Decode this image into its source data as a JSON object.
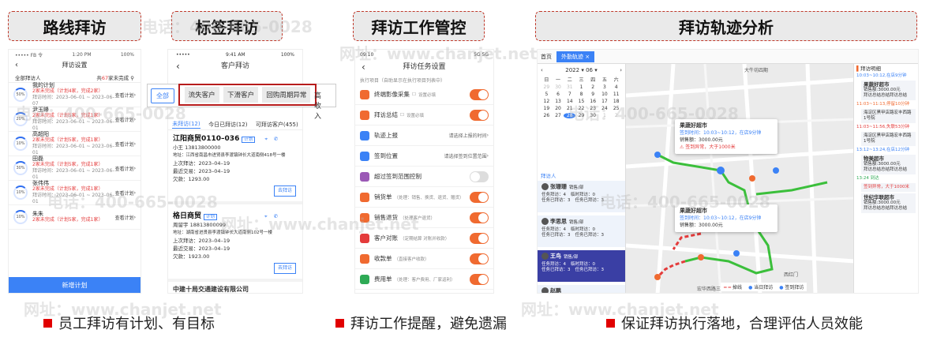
{
  "headers": [
    "路线拜访",
    "标签拜访",
    "拜访工作管控",
    "拜访轨迹分析"
  ],
  "bullets": [
    "员工拜访有计划、有目标",
    "拜访工作提醒，避免遗漏",
    "保证拜访执行落地，合理评估人员效能"
  ],
  "watermarks": {
    "phone": "电话：400-665-0028",
    "site": "网址：www.chanjet.net"
  },
  "panel1": {
    "status_left": "••••• FB 令",
    "status_time": "1:20 PM",
    "status_right": "100%",
    "title": "拜访设置",
    "sub_left": "全部拜访人",
    "sub_right_pre": "共",
    "sub_count": "67",
    "sub_right_post": "家未完成",
    "items": [
      {
        "pct": "50%",
        "name": "我的计划",
        "line": "2家未完成（计划4家，完成2家）",
        "time": "拜访时间：2023–06–01 ~ 2023–06–07",
        "act": "查看计划"
      },
      {
        "pct": "20%",
        "name": "尹玉峰",
        "line": "2家未完成（计划5家，完成1家）",
        "time": "拜访时间：2023–06–01 ~ 2023–06–01",
        "act": "查看计划"
      },
      {
        "pct": "10%",
        "name": "高超阳",
        "line": "2家未完成（计划5家，完成1家）",
        "time": "拜访时间：2023–06–01 ~ 2023–06–01",
        "act": "查看计划"
      },
      {
        "pct": "30%",
        "name": "田磊",
        "line": "2家未完成（计划5家，完成1家）",
        "time": "拜访时间：2023–06–01 ~ 2023–06–01",
        "act": "查看计划"
      },
      {
        "pct": "10%",
        "name": "张伟伟",
        "line": "2家未完成（计划5家，完成1家）",
        "time": "拜访时间：2023–06–01 ~ 2023–06–01",
        "act": "查看计划"
      },
      {
        "pct": "10%",
        "name": "朱朱",
        "line": "2家未完成（计划5家，完成1家）",
        "time": "",
        "act": "查看计划"
      }
    ],
    "new_button": "新增计划"
  },
  "panel2": {
    "status_time": "9:41 AM",
    "status_right": "100%",
    "title": "客户拜访",
    "all_tab": "全部",
    "chips": [
      "流失客户",
      "下滑客户",
      "回购周期异常",
      "高收入"
    ],
    "subtabs": [
      "未拜访(12)",
      "今日已拜访(12)",
      "可拜访客户(455)"
    ],
    "cards": [
      {
        "name": "江阳商贸0110–036",
        "tag": "计划",
        "contact": "小王 13813800000",
        "addr": "地址：江西省南昌市进贤县李渡镇钟长大道南侧418号一楼",
        "last": "上次拜访：2023–04–19",
        "recent": "最近交易：2023–04–19",
        "owe": "欠款：1293.00",
        "btn": "去拜访"
      },
      {
        "name": "格日商贸",
        "tag": "计划",
        "contact": "周留宇 18813800099",
        "addr": "地址：湖南省进贤县李渡镇钟长大道南侧102号一楼",
        "last": "上次拜访：2023–04–19",
        "recent": "最近交易：2023–04–19",
        "owe": "欠款：1923.00",
        "btn": "去拜访"
      }
    ],
    "last_card": "中建十局交通建设有限公司"
  },
  "panel3": {
    "status_time": "09:10",
    "status_right": "5G 5G",
    "title": "拜访任务设置",
    "section": "执行项目（自助显示在执行项目列表中）",
    "items": [
      {
        "label": "终端影像采集",
        "note": "设置必填",
        "right": "",
        "toggle": true,
        "color": "#f06a30"
      },
      {
        "label": "拜访总结",
        "note": "设置必填",
        "right": "",
        "toggle": true,
        "color": "#f06a30"
      },
      {
        "label": "轨迹上报",
        "note": "",
        "right": "请选择上报的时间",
        "toggle": null,
        "color": "#3b82f6"
      },
      {
        "label": "签到位置",
        "note": "",
        "right": "请选择签到位置范围",
        "toggle": null,
        "color": "#3b82f6"
      },
      {
        "label": "超过签到范围控制",
        "note": "",
        "right": "",
        "toggle": false,
        "color": "#9b59b6"
      },
      {
        "label": "销货单",
        "note": "（处理：销售、换货、退货、赠货）",
        "right": "",
        "toggle": true,
        "color": "#f06a30"
      },
      {
        "label": "销售退货",
        "note": "（处理客户退货）",
        "right": "",
        "toggle": true,
        "color": "#f06a30"
      },
      {
        "label": "客户对账",
        "note": "（定期结算 对账并收款）",
        "right": "",
        "toggle": true,
        "color": "#e43b3b"
      },
      {
        "label": "收款单",
        "note": "（直接客户收款）",
        "right": "",
        "toggle": true,
        "color": "#f06a30"
      },
      {
        "label": "费用单",
        "note": "（处理：客户费用、厂家返利）",
        "right": "",
        "toggle": true,
        "color": "#2eaa55"
      }
    ]
  },
  "panel4": {
    "home": "首页",
    "tab": "外勤轨迹",
    "tab_close": "×",
    "cal": {
      "year": "2022",
      "month": "06",
      "weekdays": [
        "日",
        "一",
        "二",
        "三",
        "四",
        "五",
        "六"
      ],
      "days": [
        "29",
        "30",
        "31",
        "1",
        "2",
        "3",
        "4",
        "5",
        "6",
        "7",
        "8",
        "9",
        "10",
        "11",
        "12",
        "13",
        "14",
        "15",
        "16",
        "17",
        "18",
        "19",
        "20",
        "21",
        "22",
        "23",
        "24",
        "25",
        "26",
        "27",
        "28",
        "29",
        "30",
        "1",
        "2"
      ],
      "selected": "28"
    },
    "visitor_title": "拜访人",
    "visitors": [
      {
        "name": "张珊珊",
        "role": "销售/部",
        "l1": "任务拜访：4",
        "l1b": "临时拜访：0",
        "l2": "任务已拜访：3",
        "l2b": "任务已拜访：3"
      },
      {
        "name": "李思思",
        "role": "销售/部",
        "l1": "任务拜访：4",
        "l1b": "临时拜访：0",
        "l2": "任务已拜访：3",
        "l2b": "任务已拜访：3"
      },
      {
        "name": "王鸟",
        "role": "销售/部",
        "l1": "任务拜访：4",
        "l1b": "临时拜访：0",
        "l2": "任务已拜访：3",
        "l2b": "任务已拜访：3"
      },
      {
        "name": "赵鹏",
        "role": "",
        "l1": "",
        "l1b": "",
        "l2": "",
        "l2b": ""
      }
    ],
    "map_labels": [
      "大牛坊四期",
      "宏华西路三站",
      "宏华西路",
      "西红门"
    ],
    "pops": [
      {
        "title": "果蔬好超市",
        "t": "签到时间：10:03~10:12，在店9分钟",
        "sale": "销售额：3000.00元",
        "warn": "签到异常，大于1000米"
      },
      {
        "title": "果蔬好超市",
        "t": "签到时间：10:03~10:12，在店9分钟",
        "sale": "销售额：3000.00元",
        "warn": ""
      }
    ],
    "legend": [
      "掉线",
      "当日拜访",
      "签到拜访"
    ],
    "right_title": "拜访明细",
    "records": [
      {
        "t": "10:03~10:12,在店9分钟",
        "c": "b",
        "title": "果蔬好超市",
        "l1": "销售额:3000.00元",
        "l2": "拜访总结总结拜访总结"
      },
      {
        "t": "11:03~11:13,停留10分钟",
        "c": "o",
        "title": "",
        "l1": "海淀区黑甲店路宏丰西路1号院",
        "l2": ""
      },
      {
        "t": "11:03~11:56,失联53分钟",
        "c": "r",
        "title": "",
        "l1": "海淀区黑甲店路宏丰西路1号院",
        "l2": ""
      },
      {
        "t": "13:12~13:24,在店12分钟",
        "c": "b",
        "title": "物美超市",
        "l1": "销售额:3000.00元",
        "l2": "拜访总结总结拜访总结"
      },
      {
        "t": "13:24 到达",
        "c": "g",
        "title": "",
        "l1": "签到异常，大于1000米",
        "l2": ""
      },
      {
        "t": "",
        "c": "",
        "title": "世纪华联超市",
        "l1": "销售额:3000.00元",
        "l2": "拜访总结总结拜访总结"
      }
    ]
  }
}
